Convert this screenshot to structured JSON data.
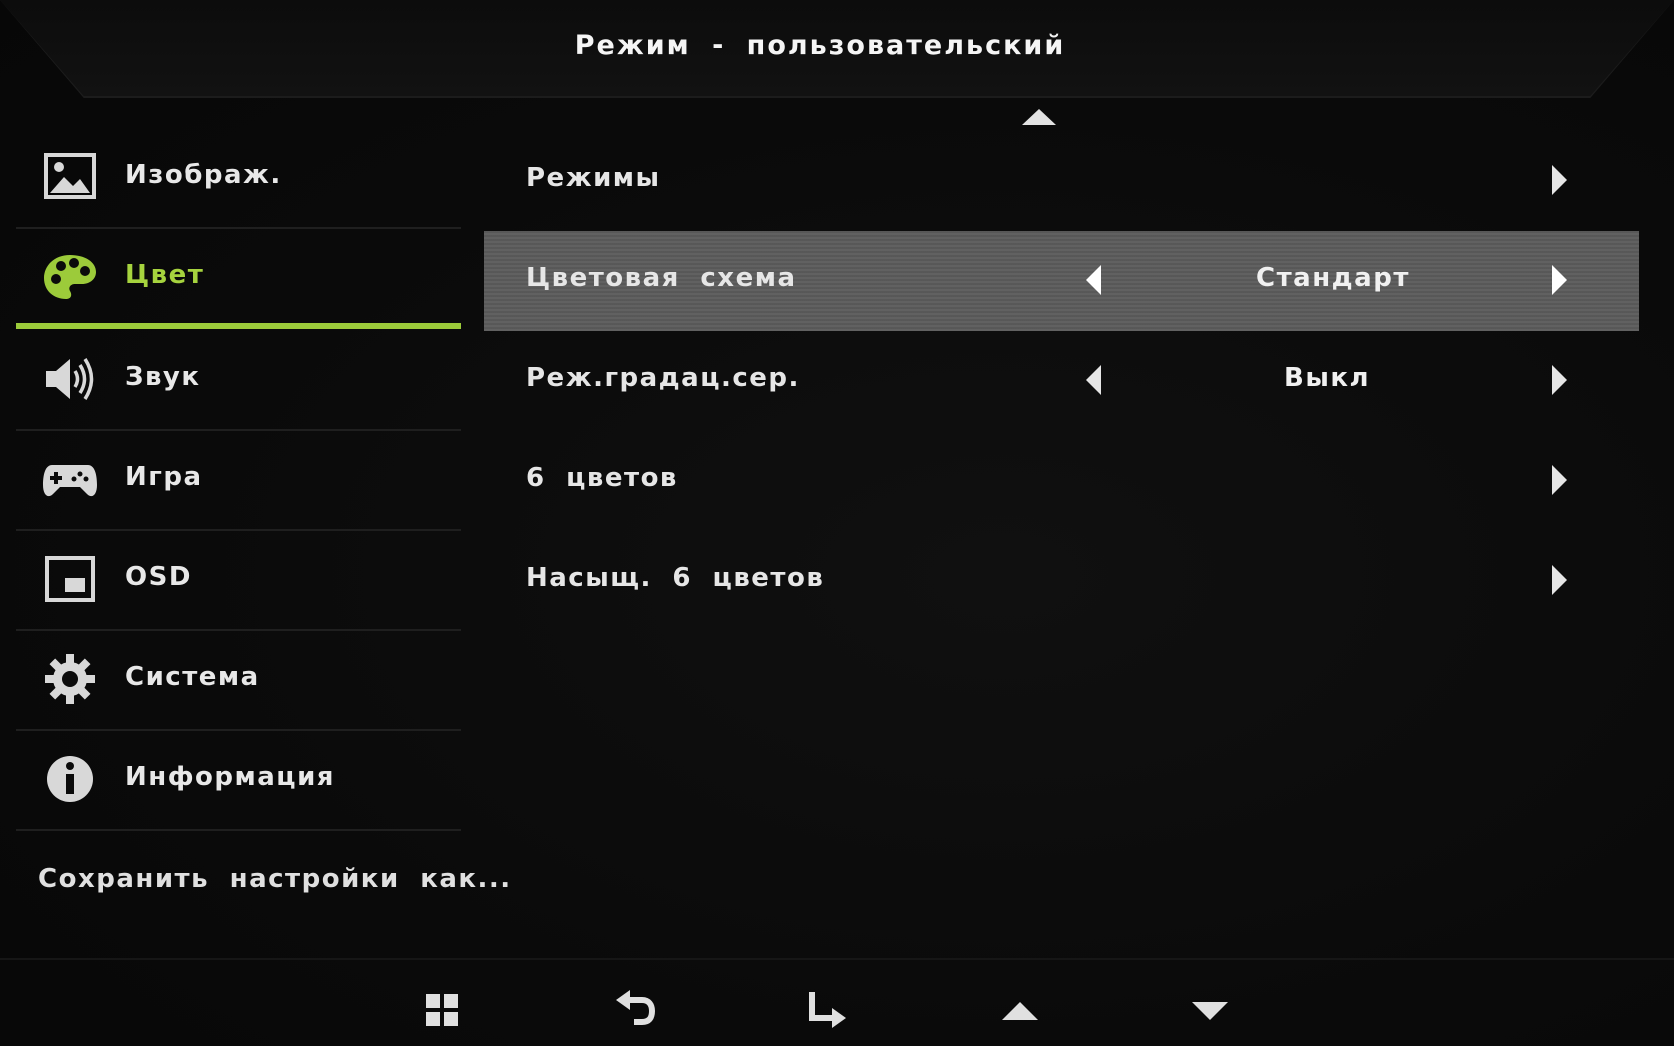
{
  "header": {
    "title": "Режим - пользовательский"
  },
  "sidebar": {
    "items": [
      {
        "label": "Изображ.",
        "icon": "image-icon"
      },
      {
        "label": "Цвет",
        "icon": "palette-icon",
        "active": true
      },
      {
        "label": "Звук",
        "icon": "speaker-icon"
      },
      {
        "label": "Игра",
        "icon": "gamepad-icon"
      },
      {
        "label": "OSD",
        "icon": "osd-window-icon"
      },
      {
        "label": "Система",
        "icon": "gear-icon"
      },
      {
        "label": "Информация",
        "icon": "info-icon"
      }
    ],
    "save_label": "Сохранить настройки как..."
  },
  "menu": {
    "rows": [
      {
        "label": "Режимы"
      },
      {
        "label": "Цветовая схема",
        "value": "Стандарт",
        "selected": true
      },
      {
        "label": "Реж.градац.сер.",
        "value": "Выкл"
      },
      {
        "label": "6 цветов"
      },
      {
        "label": "Насыщ. 6 цветов"
      }
    ]
  },
  "footer": {
    "keys": [
      "menu-grid-icon",
      "back-arrow-icon",
      "enter-arrow-icon",
      "up-arrow-icon",
      "down-arrow-icon"
    ]
  },
  "colors": {
    "accent": "#9ccb3a",
    "selected_row": "#5b5b5b",
    "background": "#0b0b0b"
  }
}
